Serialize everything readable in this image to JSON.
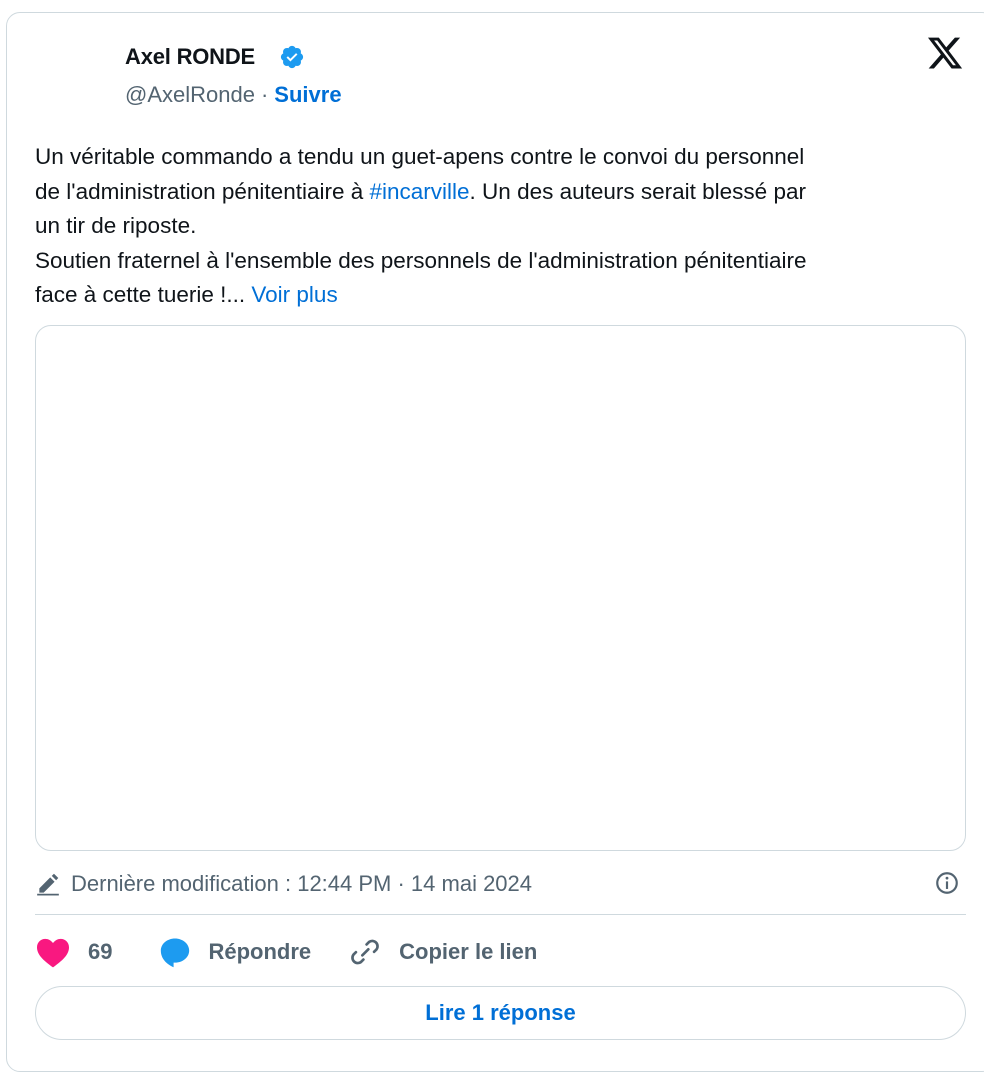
{
  "author": {
    "name": "Axel RONDE",
    "handle": "@AxelRonde",
    "separator": "·",
    "follow_label": "Suivre"
  },
  "tweet": {
    "line1": "Un véritable commando a tendu un guet-apens contre le convoi du personnel",
    "line2_before": "de l'administration pénitentiaire à ",
    "hashtag": "#incarville",
    "line2_after": ". Un des auteurs serait blessé par",
    "line3": "un tir de riposte.",
    "line4": "Soutien fraternel à l'ensemble des personnels de l'administration pénitentiaire",
    "line5": "face à cette tuerie !...",
    "more_label": "Voir plus"
  },
  "edit_info": {
    "text": "Dernière modification : 12:44 PM · 14 mai 2024"
  },
  "actions": {
    "like_count": "69",
    "reply_label": "Répondre",
    "copy_link_label": "Copier le lien"
  },
  "read_replies_label": "Lire 1 réponse",
  "icons": {
    "verified": "verified-badge-icon",
    "logo": "x-logo-icon",
    "edit": "pencil-icon",
    "info": "info-icon",
    "like": "heart-icon",
    "reply": "reply-bubble-icon",
    "link": "link-icon"
  },
  "colors": {
    "accent": "#006fd6",
    "verified": "#1d9bf0",
    "heart": "#f91880",
    "text": "#0f1419",
    "secondary": "#536471",
    "border": "#cfd9de"
  }
}
